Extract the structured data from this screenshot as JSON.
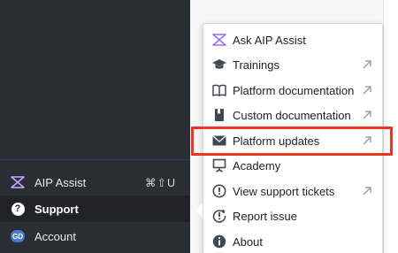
{
  "sidebar": {
    "aip_assist": {
      "label": "AIP Assist",
      "shortcut": "⌘⇧U"
    },
    "support": {
      "label": "Support"
    },
    "account": {
      "label": "Account",
      "initials": "GD"
    }
  },
  "menu": {
    "items": [
      {
        "label": "Ask AIP Assist",
        "icon": "aip-assist-icon",
        "external": false
      },
      {
        "label": "Trainings",
        "icon": "graduation-cap-icon",
        "external": true
      },
      {
        "label": "Platform documentation",
        "icon": "book-icon",
        "external": true
      },
      {
        "label": "Custom documentation",
        "icon": "bookmark-book-icon",
        "external": true
      },
      {
        "label": "Platform updates",
        "icon": "envelope-icon",
        "external": true
      },
      {
        "label": "Academy",
        "icon": "presentation-icon",
        "external": false
      },
      {
        "label": "View support tickets",
        "icon": "warning-circle-icon",
        "external": true
      },
      {
        "label": "Report issue",
        "icon": "report-issue-icon",
        "external": false
      },
      {
        "label": "About",
        "icon": "info-icon",
        "external": false
      }
    ]
  },
  "colors": {
    "highlight": "#f0341f",
    "sidebar_bg": "#2a2f36"
  }
}
